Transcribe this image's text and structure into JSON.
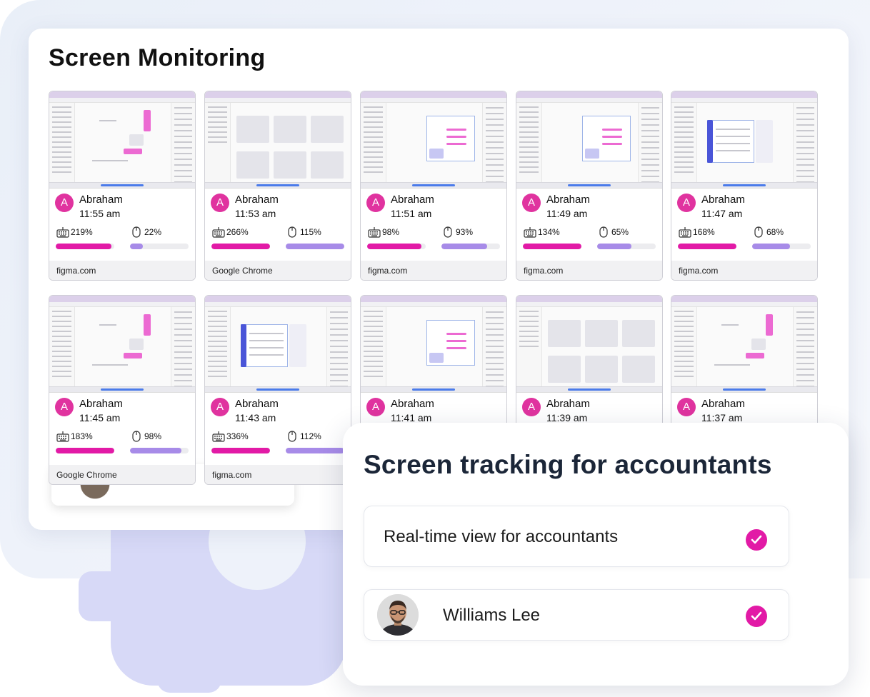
{
  "main": {
    "title": "Screen Monitoring",
    "tiles": [
      {
        "user": "Abraham",
        "avatar_letter": "A",
        "time": "11:55 am",
        "keyboard": "219%",
        "mouse": "22%",
        "keyboard_level": 0.95,
        "mouse_level": 0.22,
        "app": "figma.com",
        "shot": "figma"
      },
      {
        "user": "Abraham",
        "avatar_letter": "A",
        "time": "11:53 am",
        "keyboard": "266%",
        "mouse": "115%",
        "keyboard_level": 1.0,
        "mouse_level": 1.0,
        "app": "Google Chrome",
        "shot": "chrome"
      },
      {
        "user": "Abraham",
        "avatar_letter": "A",
        "time": "11:51 am",
        "keyboard": "98%",
        "mouse": "93%",
        "keyboard_level": 0.93,
        "mouse_level": 0.78,
        "app": "figma.com",
        "shot": "figma-chart"
      },
      {
        "user": "Abraham",
        "avatar_letter": "A",
        "time": "11:49 am",
        "keyboard": "134%",
        "mouse": "65%",
        "keyboard_level": 1.0,
        "mouse_level": 0.58,
        "app": "figma.com",
        "shot": "figma-chart"
      },
      {
        "user": "Abraham",
        "avatar_letter": "A",
        "time": "11:47 am",
        "keyboard": "168%",
        "mouse": "68%",
        "keyboard_level": 1.0,
        "mouse_level": 0.65,
        "app": "figma.com",
        "shot": "figma-blue"
      },
      {
        "user": "Abraham",
        "avatar_letter": "A",
        "time": "11:45 am",
        "keyboard": "183%",
        "mouse": "98%",
        "keyboard_level": 1.0,
        "mouse_level": 0.88,
        "app": "Google Chrome",
        "shot": "figma"
      },
      {
        "user": "Abraham",
        "avatar_letter": "A",
        "time": "11:43 am",
        "keyboard": "336%",
        "mouse": "112%",
        "keyboard_level": 1.0,
        "mouse_level": 1.0,
        "app": "figma.com",
        "shot": "figma-blue"
      },
      {
        "user": "Abraham",
        "avatar_letter": "A",
        "time": "11:41 am",
        "keyboard": "",
        "mouse": "",
        "keyboard_level": 0,
        "mouse_level": 0,
        "app": "",
        "shot": "figma-chart"
      },
      {
        "user": "Abraham",
        "avatar_letter": "A",
        "time": "11:39 am",
        "keyboard": "",
        "mouse": "",
        "keyboard_level": 0,
        "mouse_level": 0,
        "app": "",
        "shot": "chrome"
      },
      {
        "user": "Abraham",
        "avatar_letter": "A",
        "time": "11:37 am",
        "keyboard": "",
        "mouse": "",
        "keyboard_level": 0,
        "mouse_level": 0,
        "app": "",
        "shot": "figma"
      }
    ]
  },
  "popup": {
    "title": "Screen tracking for accountants",
    "option1_label": "Real-time view for accountants",
    "option2_label": "Williams Lee"
  },
  "colors": {
    "accent_pink": "#e21aa6",
    "mouse_purple": "#a78be8",
    "heading_dark": "#1b2638"
  },
  "icons": [
    "keyboard-icon",
    "mouse-icon",
    "check-icon"
  ]
}
